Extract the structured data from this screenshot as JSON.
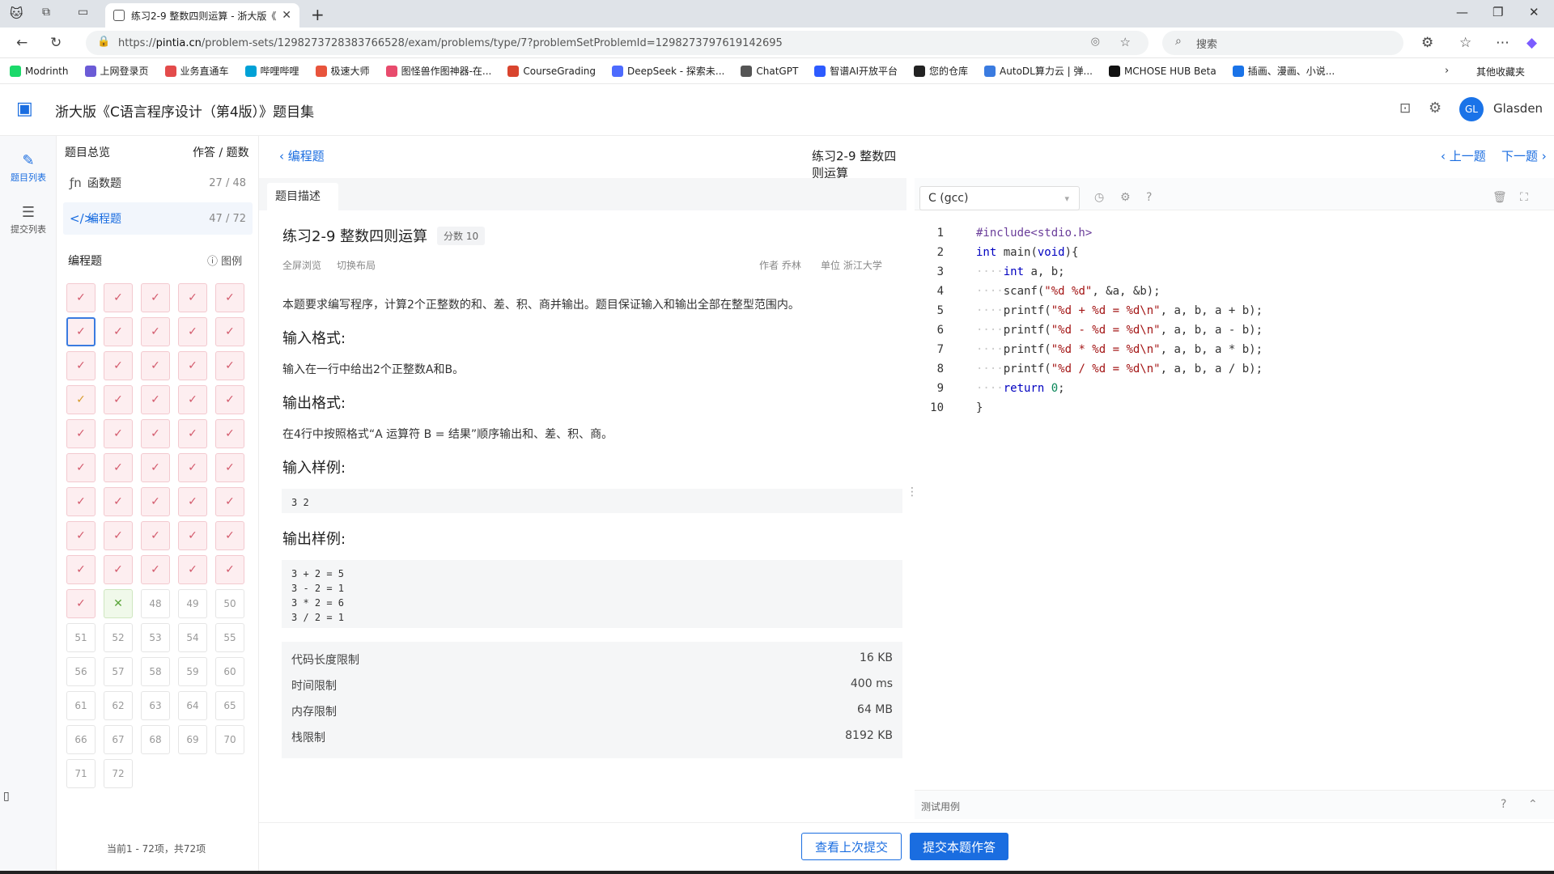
{
  "browser": {
    "tab_title": "练习2-9 整数四则运算 - 浙大版《",
    "url_prefix": "https://",
    "url_host": "pintia.cn",
    "url_path": "/problem-sets/1298273728383766528/exam/problems/type/7?problemSetProblemId=1298273797619142695",
    "search_placeholder": "搜索",
    "bookmarks": [
      {
        "label": "Modrinth",
        "color": "#1bd96a"
      },
      {
        "label": "上网登录页",
        "color": "#6b5bd6"
      },
      {
        "label": "业务直通车",
        "color": "#e34b4b"
      },
      {
        "label": "哔哩哔哩",
        "color": "#00a1d6"
      },
      {
        "label": "极速大师",
        "color": "#e8543c"
      },
      {
        "label": "图怪兽作图神器-在...",
        "color": "#e84b6d"
      },
      {
        "label": "CourseGrading",
        "color": "#d9442e"
      },
      {
        "label": "DeepSeek - 探索未...",
        "color": "#4d6bfe"
      },
      {
        "label": "ChatGPT",
        "color": "#555555"
      },
      {
        "label": "智谱AI开放平台",
        "color": "#2d5bff"
      },
      {
        "label": "您的仓库",
        "color": "#222222"
      },
      {
        "label": "AutoDL算力云 | 弹...",
        "color": "#3a7be0"
      },
      {
        "label": "MCHOSE HUB Beta",
        "color": "#111111"
      },
      {
        "label": "插画、漫画、小说...",
        "color": "#1a73e8"
      }
    ],
    "other_bookmarks": "其他收藏夹"
  },
  "app": {
    "title": "浙大版《C语言程序设计（第4版）》题目集",
    "avatar": "GL",
    "username": "Glasden"
  },
  "rail": {
    "problem_list": "题目列表",
    "submission_list": "提交列表"
  },
  "sidebar": {
    "overview": "题目总览",
    "answered_header": "作答 / 题数",
    "categories": [
      {
        "label": "函数题",
        "count": "27 / 48"
      },
      {
        "label": "编程题",
        "count": "47 / 72"
      }
    ],
    "section_title": "编程题",
    "legend": "图例",
    "cells": [
      {
        "t": "✓",
        "s": "ok"
      },
      {
        "t": "✓",
        "s": "ok"
      },
      {
        "t": "✓",
        "s": "ok"
      },
      {
        "t": "✓",
        "s": "ok"
      },
      {
        "t": "✓",
        "s": "ok"
      },
      {
        "t": "✓",
        "s": "ok cur"
      },
      {
        "t": "✓",
        "s": "ok"
      },
      {
        "t": "✓",
        "s": "ok"
      },
      {
        "t": "✓",
        "s": "ok"
      },
      {
        "t": "✓",
        "s": "ok"
      },
      {
        "t": "✓",
        "s": "ok"
      },
      {
        "t": "✓",
        "s": "ok"
      },
      {
        "t": "✓",
        "s": "ok"
      },
      {
        "t": "✓",
        "s": "ok"
      },
      {
        "t": "✓",
        "s": "ok"
      },
      {
        "t": "✓",
        "s": "ok gold"
      },
      {
        "t": "✓",
        "s": "ok"
      },
      {
        "t": "✓",
        "s": "ok"
      },
      {
        "t": "✓",
        "s": "ok"
      },
      {
        "t": "✓",
        "s": "ok"
      },
      {
        "t": "✓",
        "s": "ok"
      },
      {
        "t": "✓",
        "s": "ok"
      },
      {
        "t": "✓",
        "s": "ok"
      },
      {
        "t": "✓",
        "s": "ok"
      },
      {
        "t": "✓",
        "s": "ok"
      },
      {
        "t": "✓",
        "s": "ok"
      },
      {
        "t": "✓",
        "s": "ok"
      },
      {
        "t": "✓",
        "s": "ok"
      },
      {
        "t": "✓",
        "s": "ok"
      },
      {
        "t": "✓",
        "s": "ok"
      },
      {
        "t": "✓",
        "s": "ok"
      },
      {
        "t": "✓",
        "s": "ok"
      },
      {
        "t": "✓",
        "s": "ok"
      },
      {
        "t": "✓",
        "s": "ok"
      },
      {
        "t": "✓",
        "s": "ok"
      },
      {
        "t": "✓",
        "s": "ok"
      },
      {
        "t": "✓",
        "s": "ok"
      },
      {
        "t": "✓",
        "s": "ok"
      },
      {
        "t": "✓",
        "s": "ok"
      },
      {
        "t": "✓",
        "s": "ok"
      },
      {
        "t": "✓",
        "s": "ok"
      },
      {
        "t": "✓",
        "s": "ok"
      },
      {
        "t": "✓",
        "s": "ok"
      },
      {
        "t": "✓",
        "s": "ok"
      },
      {
        "t": "✓",
        "s": "ok"
      },
      {
        "t": "✓",
        "s": "ok"
      },
      {
        "t": "✕",
        "s": "bad"
      },
      {
        "t": "48",
        "s": ""
      },
      {
        "t": "49",
        "s": ""
      },
      {
        "t": "50",
        "s": ""
      },
      {
        "t": "51",
        "s": ""
      },
      {
        "t": "52",
        "s": ""
      },
      {
        "t": "53",
        "s": ""
      },
      {
        "t": "54",
        "s": ""
      },
      {
        "t": "55",
        "s": ""
      },
      {
        "t": "56",
        "s": ""
      },
      {
        "t": "57",
        "s": ""
      },
      {
        "t": "58",
        "s": ""
      },
      {
        "t": "59",
        "s": ""
      },
      {
        "t": "60",
        "s": ""
      },
      {
        "t": "61",
        "s": ""
      },
      {
        "t": "62",
        "s": ""
      },
      {
        "t": "63",
        "s": ""
      },
      {
        "t": "64",
        "s": ""
      },
      {
        "t": "65",
        "s": ""
      },
      {
        "t": "66",
        "s": ""
      },
      {
        "t": "67",
        "s": ""
      },
      {
        "t": "68",
        "s": ""
      },
      {
        "t": "69",
        "s": ""
      },
      {
        "t": "70",
        "s": ""
      },
      {
        "t": "71",
        "s": ""
      },
      {
        "t": "72",
        "s": ""
      }
    ],
    "footer": "当前1 - 72项，共72项"
  },
  "problem": {
    "breadcrumb": "编程题",
    "header_title": "练习2-9 整数四则运算",
    "prev": "上一题",
    "next": "下一题",
    "tab": "题目描述",
    "title": "练习2-9 整数四则运算",
    "score": "分数 10",
    "fullscreen": "全屏浏览",
    "switch_layout": "切换布局",
    "author": "作者 乔林",
    "unit": "单位 浙江大学",
    "intro": "本题要求编写程序，计算2个正整数的和、差、积、商并输出。题目保证输入和输出全部在整型范围内。",
    "input_h": "输入格式:",
    "input_p": "输入在一行中给出2个正整数A和B。",
    "output_h": "输出格式:",
    "output_p": "在4行中按照格式“A 运算符 B = 结果”顺序输出和、差、积、商。",
    "sample_in_h": "输入样例:",
    "sample_in": "3 2",
    "sample_out_h": "输出样例:",
    "sample_out": "3 + 2 = 5\n3 - 2 = 1\n3 * 2 = 6\n3 / 2 = 1",
    "limits": [
      {
        "k": "代码长度限制",
        "v": "16 KB"
      },
      {
        "k": "时间限制",
        "v": "400 ms"
      },
      {
        "k": "内存限制",
        "v": "64 MB"
      },
      {
        "k": "栈限制",
        "v": "8192 KB"
      }
    ]
  },
  "editor": {
    "language": "C (gcc)",
    "code_lines": [
      "#include<stdio.h>",
      "int main(void){",
      "    int a, b;",
      "    scanf(\"%d %d\", &a, &b);",
      "    printf(\"%d + %d = %d\\n\", a, b, a + b);",
      "    printf(\"%d - %d = %d\\n\", a, b, a - b);",
      "    printf(\"%d * %d = %d\\n\", a, b, a * b);",
      "    printf(\"%d / %d = %d\\n\", a, b, a / b);",
      "    return 0;",
      "}"
    ],
    "test_cases": "测试用例"
  },
  "actions": {
    "view_last": "查看上次提交",
    "submit": "提交本题作答"
  }
}
